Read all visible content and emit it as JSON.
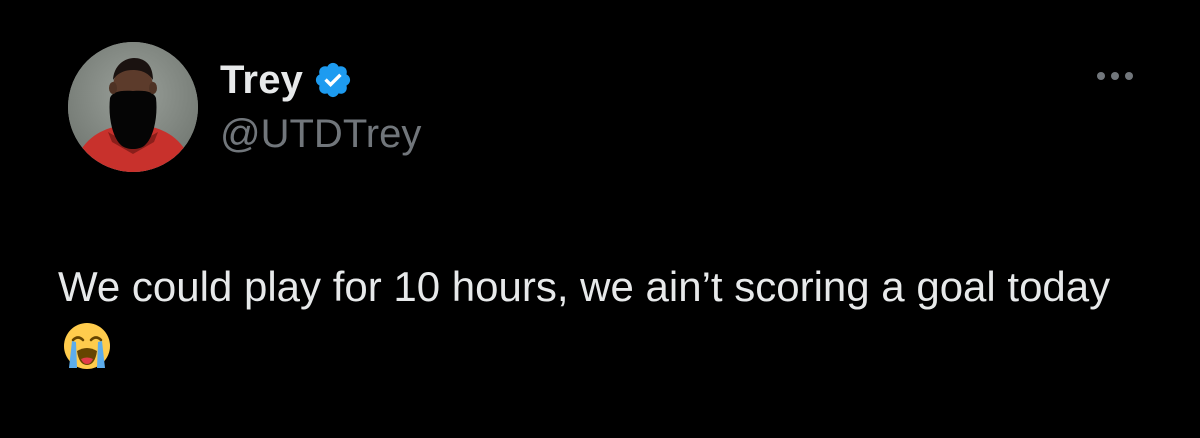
{
  "tweet": {
    "author": {
      "display_name": "Trey",
      "handle": "@UTDTrey",
      "verified": true,
      "avatar_icon": "profile-photo"
    },
    "text": "We could play for 10 hours, we ain’t scoring a goal today",
    "emoji": "loudly-crying-face",
    "more_icon": "more-horizontal-icon"
  },
  "colors": {
    "background": "#000000",
    "primary_text": "#e7e9ea",
    "secondary_text": "#71767b",
    "verified_blue": "#1d9bf0"
  }
}
